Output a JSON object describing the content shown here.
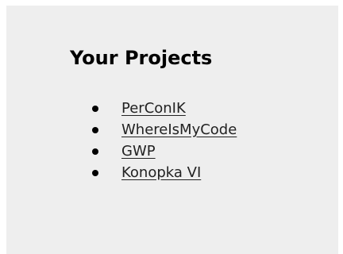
{
  "title": "Your Projects",
  "projects": [
    {
      "label": "PerConIK"
    },
    {
      "label": "WhereIsMyCode"
    },
    {
      "label": "GWP"
    },
    {
      "label": "Konopka VI"
    }
  ]
}
